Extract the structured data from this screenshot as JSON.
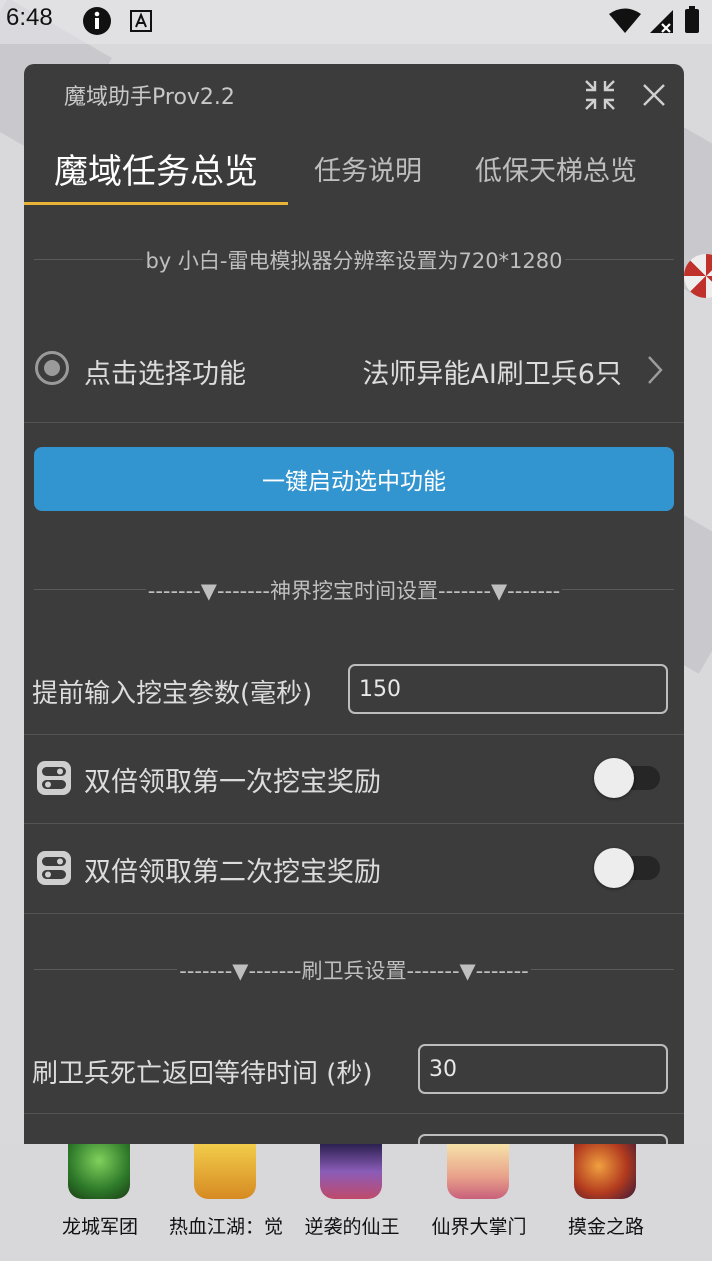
{
  "status_bar": {
    "time": "6:48"
  },
  "window": {
    "title": "魔域助手Prov2.2"
  },
  "tabs": [
    {
      "label": "魔域任务总览"
    },
    {
      "label": "任务说明"
    },
    {
      "label": "低保天梯总览"
    }
  ],
  "info_line": "by 小白-雷电模拟器分辨率设置为720*1280",
  "select_function": {
    "label": "点击选择功能",
    "value": "法师异能AI刷卫兵6只"
  },
  "start_button": "一键启动选中功能",
  "section_treasure": "-------▼-------神界挖宝时间设置-------▼-------",
  "treasure_param": {
    "label": "提前输入挖宝参数(毫秒)",
    "value": "150"
  },
  "toggles": [
    {
      "label": "双倍领取第一次挖宝奖励",
      "on": false
    },
    {
      "label": "双倍领取第二次挖宝奖励",
      "on": false
    }
  ],
  "section_guard": "-------▼-------刷卫兵设置-------▼-------",
  "guard_wait": {
    "label": "刷卫兵死亡返回等待时间 (秒)",
    "value": "30"
  },
  "dock_apps": [
    {
      "label": "龙城军团",
      "icon": "dragon-game-icon",
      "color": "#2e7a2a"
    },
    {
      "label": "热血江湖：觉",
      "icon": "jianghu-game-icon",
      "color": "#e6b23a"
    },
    {
      "label": "逆袭的仙王",
      "icon": "xianwang-game-icon",
      "color": "#6a4a9a"
    },
    {
      "label": "仙界大掌门",
      "icon": "zhangmen-game-icon",
      "color": "#e9b8a8"
    },
    {
      "label": "摸金之路",
      "icon": "mojin-game-icon",
      "color": "#b23a1e"
    }
  ],
  "colors": {
    "accent": "#e9b437",
    "button": "#3395d0",
    "panel": "#3c3c3c"
  }
}
